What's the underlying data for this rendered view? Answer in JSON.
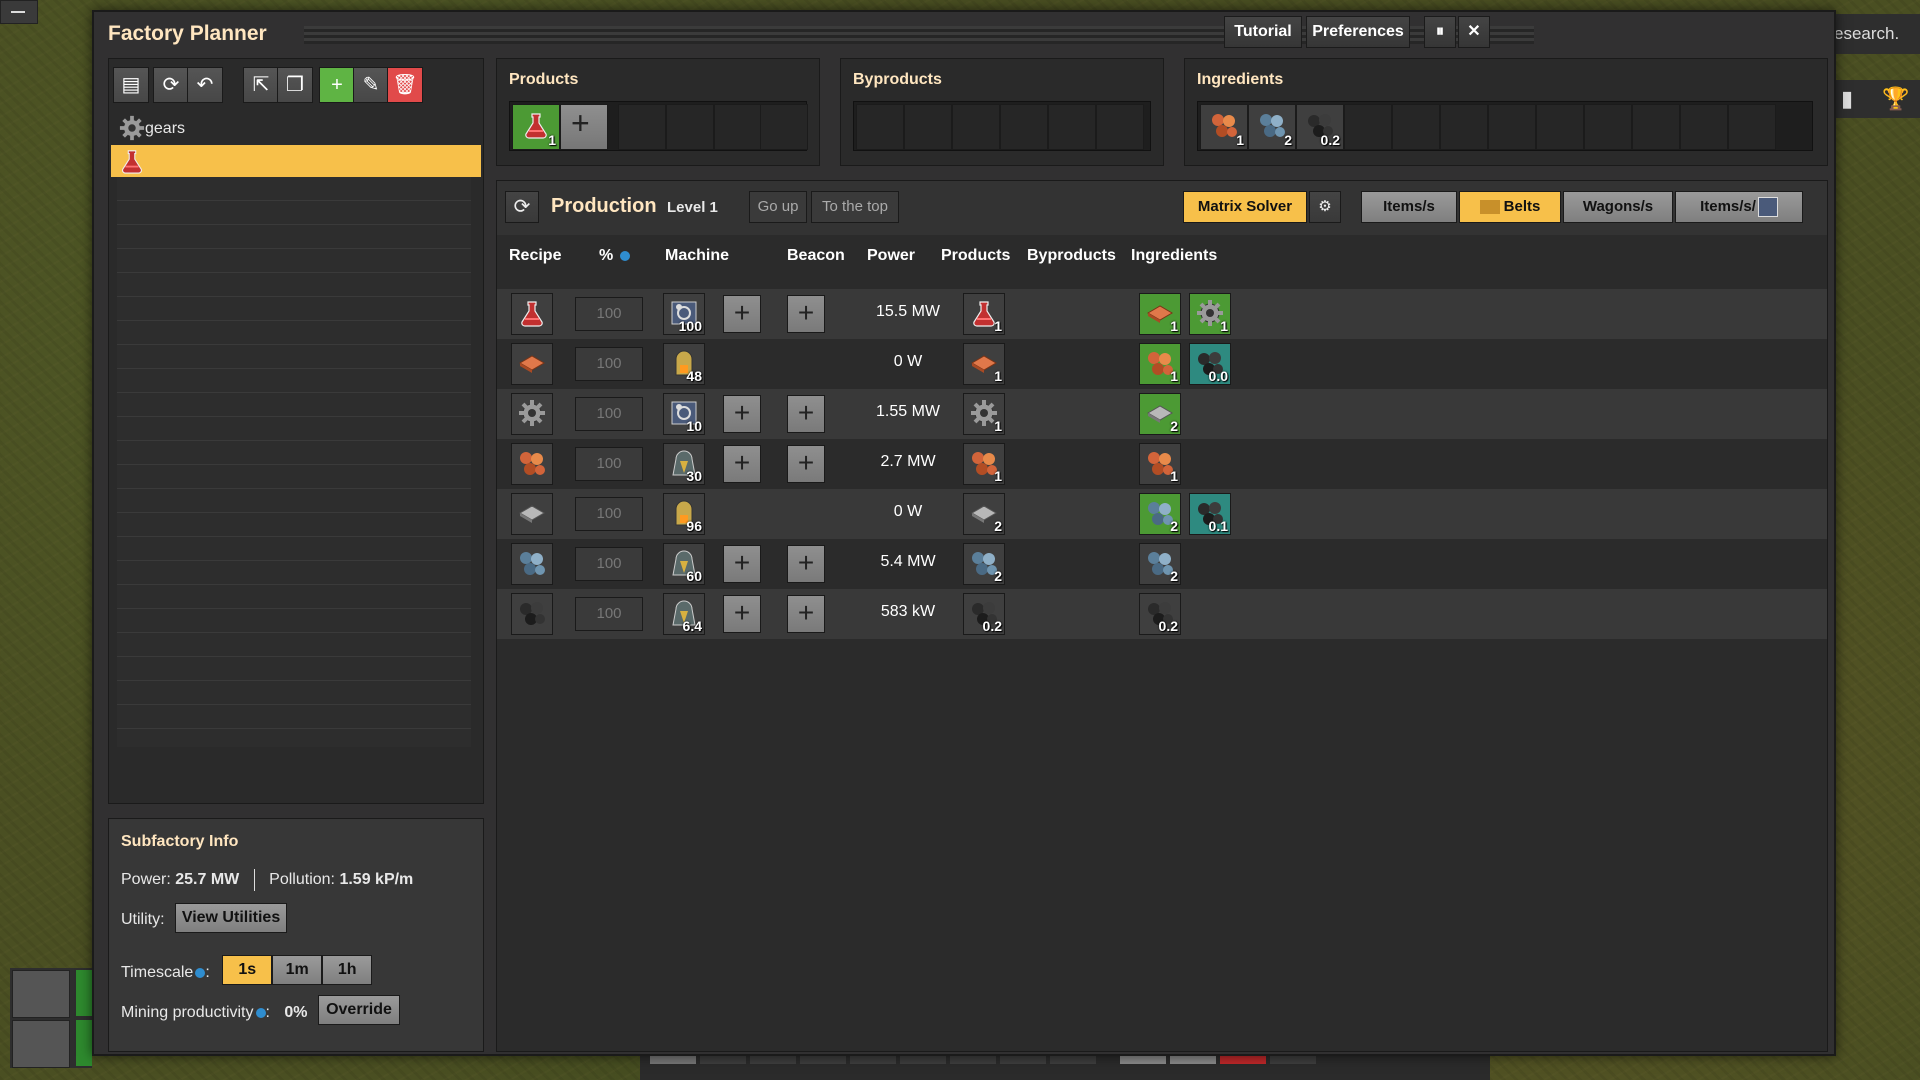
{
  "window": {
    "title": "Factory Planner",
    "buttons": {
      "tutorial": "Tutorial",
      "preferences": "Preferences",
      "pause": "⏸",
      "close": "✕"
    }
  },
  "background": {
    "research_text": "esearch."
  },
  "subfactories": [
    {
      "name": "gears",
      "icon": "gear-icon",
      "selected": false
    },
    {
      "name": "",
      "icon": "red-science-icon",
      "selected": true
    }
  ],
  "toolbar_icons": [
    "archive-icon",
    "refresh-icon",
    "undo-icon",
    "export-icon",
    "duplicate-icon",
    "add-icon",
    "edit-icon",
    "delete-icon"
  ],
  "info": {
    "title": "Subfactory Info",
    "power_label": "Power:",
    "power_value": "25.7 MW",
    "pollution_label": "Pollution:",
    "pollution_value": "1.59 kP/m",
    "utility_label": "Utility:",
    "utility_button": "View Utilities",
    "timescale_label": "Timescale",
    "timescales": [
      "1s",
      "1m",
      "1h"
    ],
    "timescale_selected": "1s",
    "mining_label": "Mining productivity",
    "mining_value": "0%",
    "override_button": "Override"
  },
  "products_box": {
    "title": "Products",
    "items": [
      {
        "icon": "red-science-icon",
        "amount": "1"
      }
    ]
  },
  "byproducts_box": {
    "title": "Byproducts"
  },
  "ingredients_box": {
    "title": "Ingredients",
    "items": [
      {
        "icon": "copper-ore-icon",
        "amount": "1"
      },
      {
        "icon": "iron-ore-icon",
        "amount": "2"
      },
      {
        "icon": "coal-icon",
        "amount": "0.2"
      }
    ]
  },
  "production": {
    "title": "Production",
    "level": "Level 1",
    "go_up": "Go up",
    "to_top": "To the top",
    "solver": "Matrix Solver",
    "views": [
      "Items/s",
      "Belts",
      "Wagons/s",
      "Items/s/"
    ],
    "view_selected": "Belts",
    "columns": [
      "Recipe",
      "%",
      "Machine",
      "Beacon",
      "Power",
      "Products",
      "Byproducts",
      "Ingredients"
    ],
    "rows": [
      {
        "recipe": "red-science-icon",
        "pct": "100",
        "machine": "assembler-icon",
        "machine_count": "100",
        "has_modules": true,
        "power": "15.5 MW",
        "products": [
          {
            "icon": "red-science-icon",
            "amount": "1"
          }
        ],
        "ingredients": [
          {
            "icon": "copper-plate-icon",
            "amount": "1",
            "color": "green"
          },
          {
            "icon": "gear-icon",
            "amount": "1",
            "color": "green"
          }
        ]
      },
      {
        "recipe": "copper-plate-icon",
        "pct": "100",
        "machine": "furnace-icon",
        "machine_count": "48",
        "has_modules": false,
        "power": "0 W",
        "products": [
          {
            "icon": "copper-plate-icon",
            "amount": "1"
          }
        ],
        "ingredients": [
          {
            "icon": "copper-ore-icon",
            "amount": "1",
            "color": "green"
          },
          {
            "icon": "coal-icon",
            "amount": "0.0",
            "color": "teal"
          }
        ]
      },
      {
        "recipe": "gear-icon",
        "pct": "100",
        "machine": "assembler-icon",
        "machine_count": "10",
        "has_modules": true,
        "power": "1.55 MW",
        "products": [
          {
            "icon": "gear-icon",
            "amount": "1"
          }
        ],
        "ingredients": [
          {
            "icon": "iron-plate-icon",
            "amount": "2",
            "color": "green"
          }
        ]
      },
      {
        "recipe": "copper-ore-icon",
        "pct": "100",
        "machine": "drill-icon",
        "machine_count": "30",
        "has_modules": true,
        "power": "2.7 MW",
        "products": [
          {
            "icon": "copper-ore-icon",
            "amount": "1"
          }
        ],
        "ingredients": [
          {
            "icon": "copper-ore-icon",
            "amount": "1",
            "color": "none"
          }
        ]
      },
      {
        "recipe": "iron-plate-icon",
        "pct": "100",
        "machine": "furnace-icon",
        "machine_count": "96",
        "has_modules": false,
        "power": "0 W",
        "products": [
          {
            "icon": "iron-plate-icon",
            "amount": "2"
          }
        ],
        "ingredients": [
          {
            "icon": "iron-ore-icon",
            "amount": "2",
            "color": "green"
          },
          {
            "icon": "coal-icon",
            "amount": "0.1",
            "color": "teal"
          }
        ]
      },
      {
        "recipe": "iron-ore-icon",
        "pct": "100",
        "machine": "drill-icon",
        "machine_count": "60",
        "has_modules": true,
        "power": "5.4 MW",
        "products": [
          {
            "icon": "iron-ore-icon",
            "amount": "2"
          }
        ],
        "ingredients": [
          {
            "icon": "iron-ore-icon",
            "amount": "2",
            "color": "none"
          }
        ]
      },
      {
        "recipe": "coal-icon",
        "pct": "100",
        "machine": "drill-icon",
        "machine_count": "6.4",
        "has_modules": true,
        "power": "583 kW",
        "products": [
          {
            "icon": "coal-icon",
            "amount": "0.2"
          }
        ],
        "ingredients": [
          {
            "icon": "coal-icon",
            "amount": "0.2",
            "color": "none"
          }
        ]
      }
    ]
  },
  "colors": {
    "accent": "#f7c04a",
    "green_slot": "#4c9a34",
    "teal_slot": "#2e8a80",
    "title": "#ffe6c0"
  }
}
